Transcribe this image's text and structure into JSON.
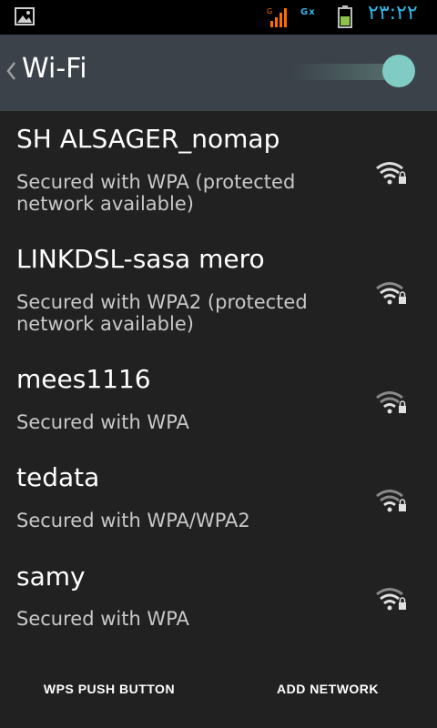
{
  "status_bar": {
    "gallery_icon": "image-icon",
    "signal_icon": "signal-icon",
    "data_label": "Gx",
    "battery_icon": "battery-icon",
    "time": "٢٣:٢٢"
  },
  "action_bar": {
    "back_icon": "chevron-left-icon",
    "title": "Wi-Fi",
    "toggle_state": "on",
    "toggle_color": "#80cbc4"
  },
  "networks": [
    {
      "name": "SH ALSAGER_nomap",
      "status": "Secured with WPA (protected network available)",
      "icon": "wifi-locked-icon"
    },
    {
      "name": "LINKDSL-sasa mero",
      "status": "Secured with WPA2 (protected network available)",
      "icon": "wifi-locked-icon"
    },
    {
      "name": "mees1116",
      "status": "Secured with WPA",
      "icon": "wifi-locked-icon"
    },
    {
      "name": "tedata",
      "status": "Secured with WPA/WPA2",
      "icon": "wifi-locked-icon"
    },
    {
      "name": "samy",
      "status": "Secured with WPA",
      "icon": "wifi-locked-icon"
    }
  ],
  "bottom_bar": {
    "wps_label": "WPS PUSH BUTTON",
    "add_label": "ADD NETWORK"
  }
}
